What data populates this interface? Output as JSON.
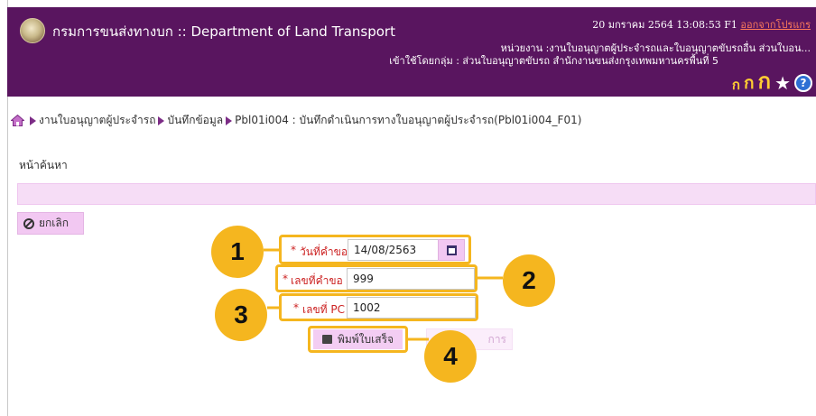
{
  "header": {
    "app_title": "กรมการขนส่งทางบก :: Department of Land Transport",
    "datetime": "20 มกราคม 2564 13:08:53 F1",
    "logout_label": "ออกจากโปรแกร",
    "agency": "หน่วยงาน :งานใบอนุญาตผู้ประจำรถและใบอนุญาตขับรถอื่น ส่วนใบอน...",
    "user_group": "เข้าใช้โดยกลุ่ม : ส่วนใบอนุญาตขับรถ สำนักงานขนส่งกรุงเทพมหานครพื้นที่ 5",
    "font_small": "ก",
    "font_medium": "ก",
    "font_large": "ก",
    "star_icon": "★",
    "help_label": "?"
  },
  "breadcrumb": {
    "items": [
      "งานใบอนุญาตผู้ประจำรถ",
      "บันทึกข้อมูล",
      "Pbl01i004 : บันทึกดำเนินการทางใบอนุญาตผู้ประจำรถ(Pbl01i004_F01)"
    ]
  },
  "page": {
    "heading": "หน้าค้นหา",
    "cancel_label": "ยกเลิก"
  },
  "form": {
    "request_date_label": "วันที่คำขอ",
    "request_date_value": "14/08/2563",
    "request_no_label": "เลขที่คำขอ",
    "request_no_value": "999",
    "pc_no_label": "เลขที่ PC",
    "pc_no_value": "1002",
    "required_mark": "*",
    "print_label": "พิมพ์ใบเสร็จ",
    "ghost_label": "การ"
  },
  "steps": [
    "1",
    "2",
    "3",
    "4"
  ],
  "colors": {
    "header_bg": "#59155f",
    "accent_pink": "#f2c8f2",
    "highlight": "#f5b61f",
    "required_red": "#cc2222"
  }
}
